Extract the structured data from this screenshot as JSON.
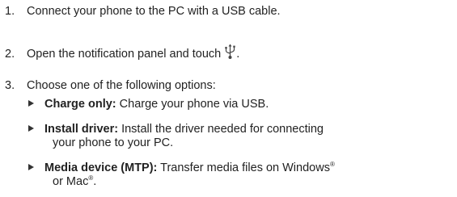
{
  "steps": [
    {
      "num": "1.",
      "text": "Connect your phone to the PC with a USB cable."
    },
    {
      "num": "2.",
      "text": "Open the notification panel and touch",
      "icon": "usb-icon",
      "after": "."
    },
    {
      "num": "3.",
      "text": "Choose one of the following options:"
    }
  ],
  "options": [
    {
      "label": "Charge only:",
      "text": " Charge your phone via USB."
    },
    {
      "label": "Install driver:",
      "text": " Install the driver needed for connecting",
      "text2": "your phone to your PC."
    },
    {
      "label": "Media device (MTP):",
      "text": " Transfer media files on Windows",
      "sup1": "®",
      "text2": "or Mac",
      "sup2": "®",
      "text2_end": "."
    }
  ]
}
